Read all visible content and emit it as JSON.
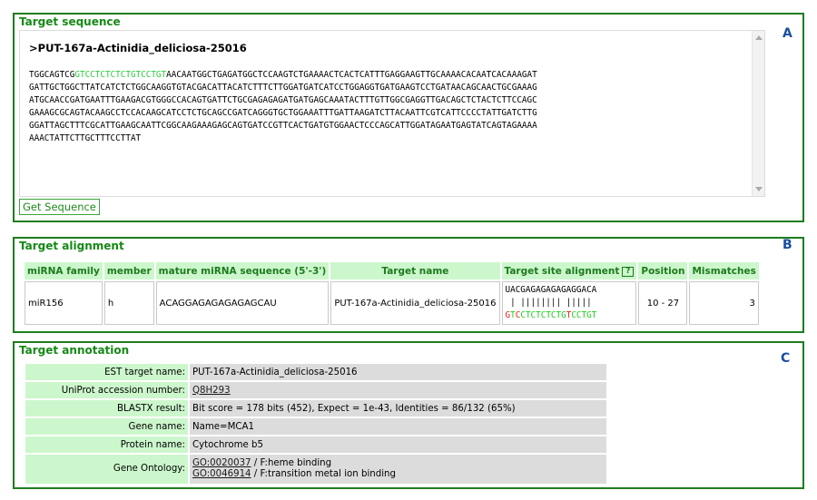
{
  "panelA": {
    "title": "Target sequence",
    "letter": "A",
    "header": ">PUT-167a-Actinidia_deliciosa-25016",
    "seq_prefix": "TGGCAGTCG",
    "seq_site": "GTCCTCTCTCTGTCCTGT",
    "seq_line1_rest": "AACAATGGCTGAGATGGCTCCAAGTCTGAAAACTCACTCATTTGAGGAAGTTGCAAAACACAATCACAAAGAT",
    "seq_lines": [
      "GATTGCTGGCTTATCATCTCTGGCAAGGTGTACGACATTACATCTTTCTTGGATGATCATCCTGGAGGTGATGAAGTCCTGATAACAGCAACTGCGAAAG",
      "ATGCAACCGATGAATTTGAAGACGTGGGCCACAGTGATTCTGCGAGAGAGATGATGAGCAAATACTTTGTTGGCGAGGTTGACAGCTCTACTCTTCCAGC",
      "GAAAGCGCAGTACAAGCCTCCACAAGCATCCTCTGCAGCCGATCAGGGTGCTGGAAATTTGATTAAGATCTTACAATTCGTCATTCCCCTATTGATCTTG",
      "GGATTAGCTTTCGCATTGAAGCAATTCGGCAAGAAAGAGCAGTGATCCGTTCACTGATGTGGAACTCCCAGCATTGGATAGAATGAGTATCAGTAGAAAA",
      "AAACTATTCTTGCTTTCCTTAT"
    ],
    "button_label": "Get Sequence"
  },
  "panelB": {
    "title": "Target alignment",
    "letter": "B",
    "headers": [
      "miRNA family",
      "member",
      "mature miRNA sequence (5'-3')",
      "Target name",
      "Target site alignment",
      "Position",
      "Mismatches"
    ],
    "help_label": "?",
    "row": {
      "family": "miR156",
      "member": "h",
      "mature": "ACAGGAGAGAGAGAGCAU",
      "target": "PUT-167a-Actinidia_deliciosa-25016",
      "align_top": "UACGAGAGAGAGAGGACA",
      "align_mid": " | |||||||| |||||",
      "align_bottom": [
        {
          "t": "G",
          "c": "red"
        },
        {
          "t": "T",
          "c": "green"
        },
        {
          "t": "C",
          "c": "red"
        },
        {
          "t": "CTCTCTCTG",
          "c": "green"
        },
        {
          "t": "T",
          "c": "red"
        },
        {
          "t": "CCTGT",
          "c": "green"
        }
      ],
      "position": "10 - 27",
      "mismatches": "3"
    }
  },
  "panelC": {
    "title": "Target annotation",
    "letter": "C",
    "rows": [
      {
        "label": "EST target name:",
        "value": "PUT-167a-Actinidia_deliciosa-25016"
      },
      {
        "label": "UniProt accession number:",
        "link": "Q8H293"
      },
      {
        "label": "BLASTX result:",
        "value": "Bit score = 178 bits (452), Expect = 1e-43, Identities = 86/132 (65%)"
      },
      {
        "label": "Gene name:",
        "value": "Name=MCA1"
      },
      {
        "label": "Protein name:",
        "value": "Cytochrome b5"
      }
    ],
    "go": {
      "label": "Gene Ontology:",
      "terms": [
        {
          "id": "GO:0020037",
          "desc": " / F:heme binding"
        },
        {
          "id": "GO:0046914",
          "desc": " / F:transition metal ion binding"
        }
      ]
    }
  },
  "colors": {
    "border": "#1e7d1e",
    "title": "#158a15",
    "header_bg": "#ccf7cc",
    "value_bg": "#dcdcdc",
    "site_green": "#2ecc40",
    "mismatch_red": "#e02020",
    "letter": "#1a4fa0"
  }
}
